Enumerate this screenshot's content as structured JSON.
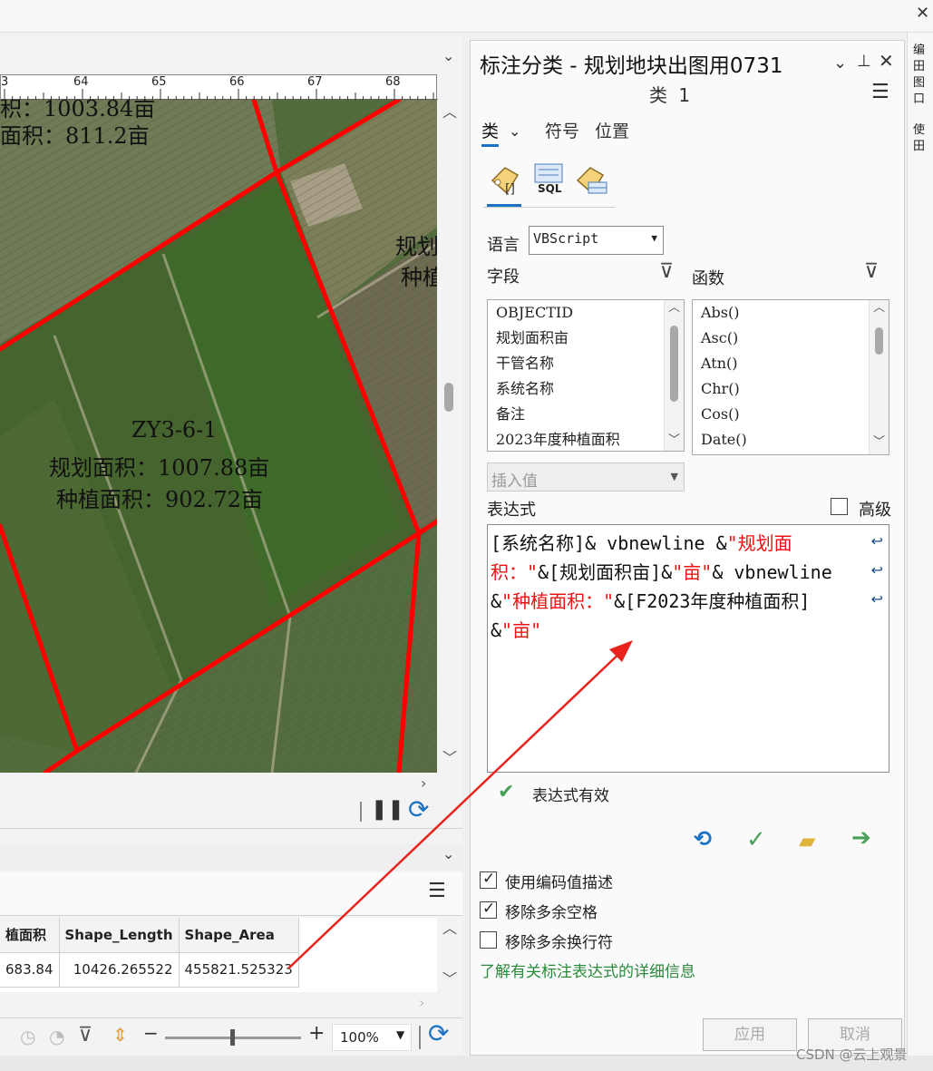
{
  "ruler": {
    "labels": [
      "3",
      "64",
      "65",
      "66",
      "67",
      "68"
    ]
  },
  "map": {
    "top_line1": "积：1003.84亩",
    "top_line2": "面积：811.2亩",
    "parcel_id": "ZY3-6-1",
    "parcel_line2": "规划面积：1007.88亩",
    "parcel_line3": "种植面积：902.72亩",
    "right_label1": "规划",
    "right_label2": "种植"
  },
  "table": {
    "headers": [
      "植面积",
      "Shape_Length",
      "Shape_Area"
    ],
    "row": [
      "683.84",
      "10426.265522",
      "455821.525323"
    ]
  },
  "map_footer": {
    "zoom": "100%"
  },
  "panel": {
    "title": "标注分类 - 规划地块出图用0731",
    "class_name": "类 1",
    "tabs": [
      "类",
      "符号",
      "位置"
    ],
    "sql_label": "SQL",
    "language_label": "语言",
    "language_value": "VBScript",
    "fields_label": "字段",
    "functions_label": "函数",
    "fields": [
      "OBJECTID",
      "规划面积亩",
      "干管名称",
      "系统名称",
      "备注",
      "2023年度种植面积"
    ],
    "functions": [
      "Abs()",
      "Asc()",
      "Atn()",
      "Chr()",
      "Cos()",
      "Date()"
    ],
    "insert_value": "插入值",
    "expression_label": "表达式",
    "advanced_label": "高级",
    "expr": {
      "l1a": "[系统名称]& vbnewline &",
      "l1b": "\"规划面",
      "l2a": "积：\"",
      "l2b": "&[规划面积亩]&",
      "l2c": "\"亩\"",
      "l2d": "& vbnewline",
      "l3a": "&",
      "l3b": "\"种植面积：\"",
      "l3c": "&[F2023年度种植面积]",
      "l4a": "&",
      "l4b": "\"亩\""
    },
    "valid_text": "表达式有效",
    "options": [
      {
        "label": "使用编码值描述",
        "checked": true
      },
      {
        "label": "移除多余空格",
        "checked": true
      },
      {
        "label": "移除多余换行符",
        "checked": false
      }
    ],
    "help_link": "了解有关标注表达式的详细信息",
    "apply_label": "应用",
    "cancel_label": "取消"
  },
  "side_strip": {
    "text1": "编",
    "text2": "田",
    "text3": "图",
    "text4": "口",
    "text5": "使",
    "text6": "田"
  },
  "watermark": "CSDN @云上观景",
  "colors": {
    "accent": "#1a73c5",
    "red_road": "#ff0000",
    "valid_green": "#4aa05a",
    "arrow_red": "#e8221c"
  }
}
